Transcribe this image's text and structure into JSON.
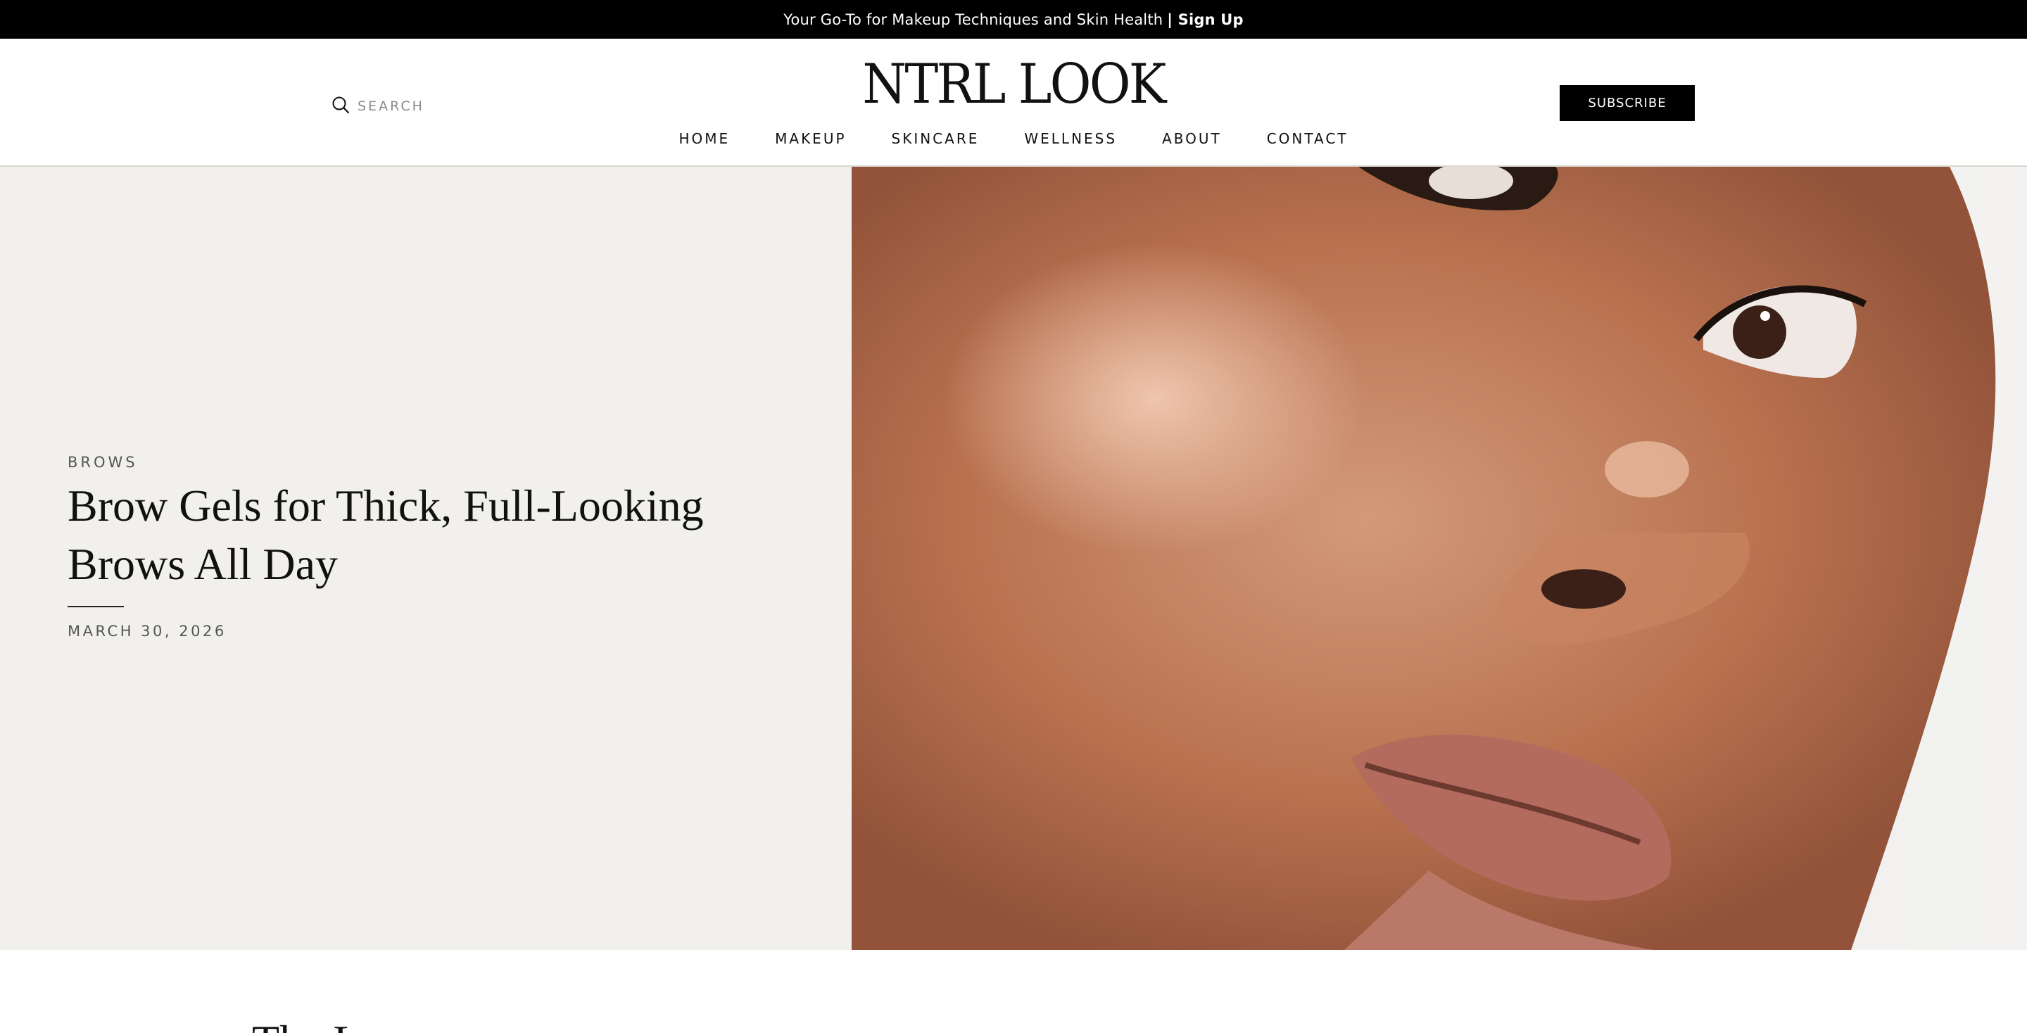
{
  "topbar": {
    "text": "Your Go-To for Makeup Techniques and Skin Health",
    "signup_label": "| Sign Up"
  },
  "header": {
    "search_placeholder": "SEARCH",
    "logo": "NTRL LOOK",
    "subscribe_label": "SUBSCRIBE",
    "nav": [
      {
        "label": "HOME"
      },
      {
        "label": "MAKEUP"
      },
      {
        "label": "SKINCARE"
      },
      {
        "label": "WELLNESS"
      },
      {
        "label": "ABOUT"
      },
      {
        "label": "CONTACT"
      }
    ]
  },
  "hero": {
    "category": "BROWS",
    "title": "Brow Gels for Thick, Full-Looking Brows All Day",
    "date": "MARCH 30, 2026"
  },
  "section": {
    "heading": "The L"
  },
  "colors": {
    "topbar_bg": "#000000",
    "hero_panel_bg": "#f1f0ed",
    "button_bg": "#000000",
    "text": "#111111",
    "muted_text": "#555555"
  },
  "icons": {
    "search": "search-icon"
  }
}
